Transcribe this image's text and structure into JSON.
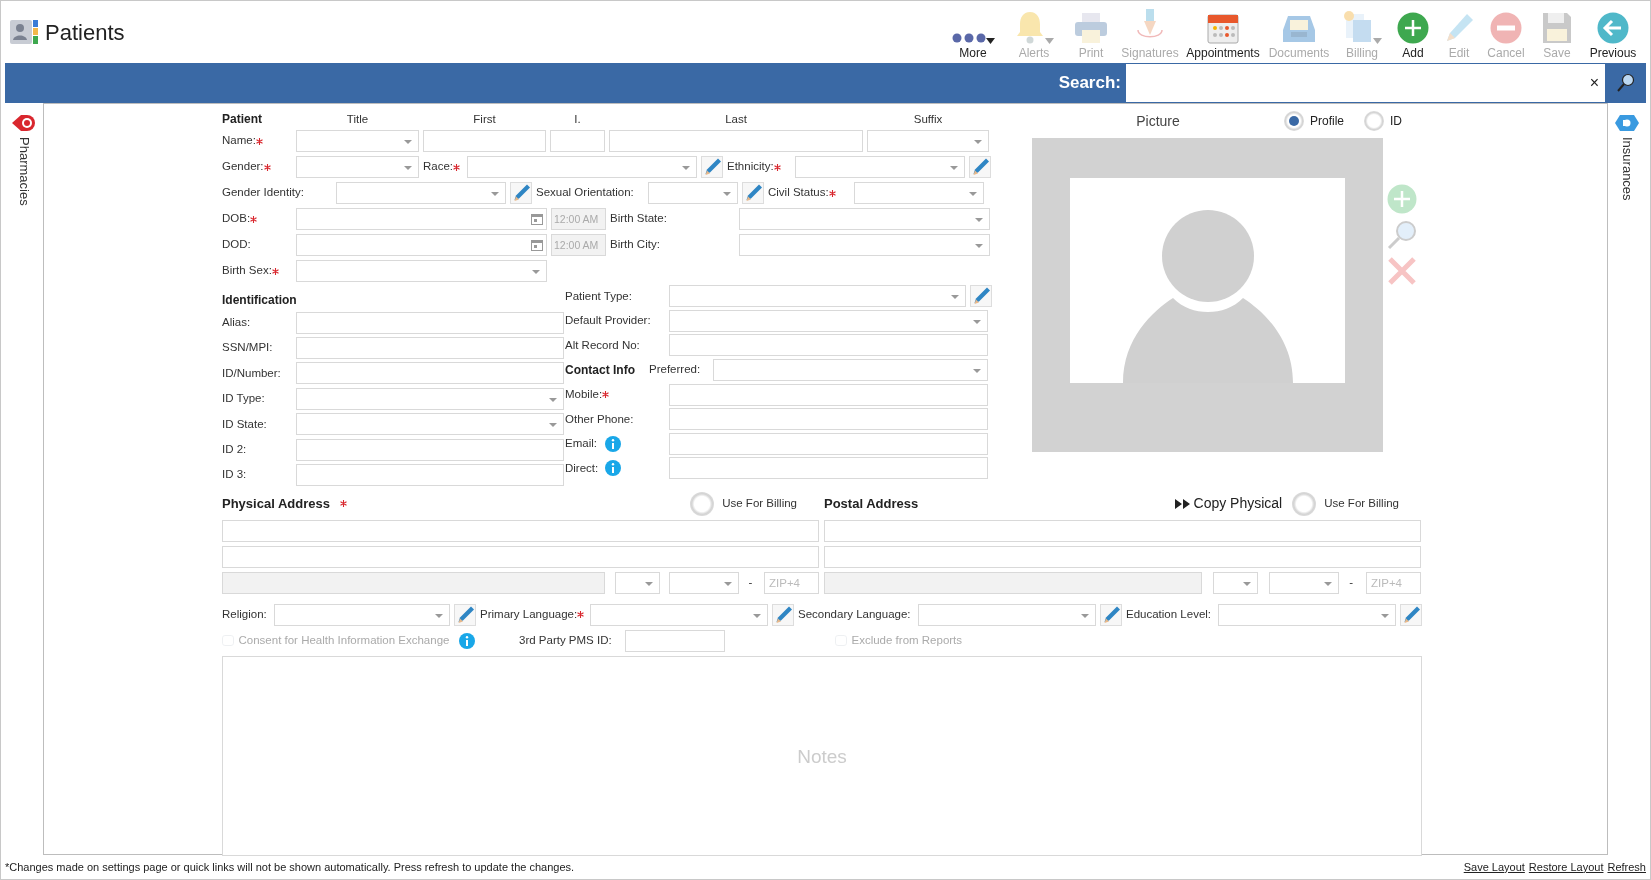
{
  "app": {
    "title": "Patients"
  },
  "toolbar": [
    {
      "label": "More",
      "kind": "more",
      "disabled": false,
      "dropdown": true
    },
    {
      "label": "Alerts",
      "kind": "bell",
      "disabled": true,
      "dropdown": true
    },
    {
      "label": "Print",
      "kind": "printer",
      "disabled": true,
      "dropdown": false
    },
    {
      "label": "Signatures",
      "kind": "pen",
      "disabled": true,
      "dropdown": false
    },
    {
      "label": "Appointments",
      "kind": "calendar",
      "disabled": false,
      "dropdown": false
    },
    {
      "label": "Documents",
      "kind": "tray",
      "disabled": true,
      "dropdown": false
    },
    {
      "label": "Billing",
      "kind": "billing",
      "disabled": true,
      "dropdown": true
    },
    {
      "label": "Add",
      "kind": "add",
      "disabled": false,
      "dropdown": false
    },
    {
      "label": "Edit",
      "kind": "edit",
      "disabled": true,
      "dropdown": false
    },
    {
      "label": "Cancel",
      "kind": "cancel",
      "disabled": true,
      "dropdown": false
    },
    {
      "label": "Save",
      "kind": "save",
      "disabled": true,
      "dropdown": false
    },
    {
      "label": "Previous",
      "kind": "back",
      "disabled": false,
      "dropdown": false
    }
  ],
  "search": {
    "label": "Search:",
    "clear": "×"
  },
  "left_tab": {
    "label": "Pharmacies"
  },
  "right_tab": {
    "label": "Insurances"
  },
  "patient": {
    "heading": "Patient",
    "name_captions": [
      "Title",
      "First",
      "I.",
      "Last",
      "Suffix"
    ],
    "rows": [
      [
        {
          "kind": "label",
          "text": "Name:",
          "required": true
        },
        {
          "kind": "select"
        },
        {
          "kind": "input"
        },
        {
          "kind": "input"
        },
        {
          "kind": "input"
        },
        {
          "kind": "select"
        }
      ],
      [
        {
          "kind": "label",
          "text": "Gender:",
          "required": true
        },
        {
          "kind": "select"
        },
        {
          "kind": "label",
          "text": "Race:",
          "required": true
        },
        {
          "kind": "select"
        },
        {
          "kind": "pencil"
        },
        {
          "kind": "label",
          "text": "Ethnicity:",
          "required": true
        },
        {
          "kind": "select"
        },
        {
          "kind": "pencil"
        }
      ],
      [
        {
          "kind": "label",
          "text": "Gender Identity:",
          "required": false
        },
        {
          "kind": "select"
        },
        {
          "kind": "pencil"
        },
        {
          "kind": "label",
          "text": "Sexual Orientation:",
          "required": false
        },
        {
          "kind": "select"
        },
        {
          "kind": "pencil"
        },
        {
          "kind": "label",
          "text": "Civil Status:",
          "required": true
        },
        {
          "kind": "select"
        }
      ],
      [
        {
          "kind": "label",
          "text": "DOB:",
          "required": true
        },
        {
          "kind": "date"
        },
        {
          "kind": "time",
          "value": "12:00 AM",
          "disabled": true
        },
        {
          "kind": "label",
          "text": "Birth State:",
          "required": false
        },
        {
          "kind": "select"
        }
      ],
      [
        {
          "kind": "label",
          "text": "DOD:",
          "required": false
        },
        {
          "kind": "date"
        },
        {
          "kind": "time",
          "value": "12:00 AM",
          "disabled": true
        },
        {
          "kind": "label",
          "text": "Birth City:",
          "required": false
        },
        {
          "kind": "select"
        }
      ],
      [
        {
          "kind": "label",
          "text": "Birth Sex:",
          "required": true
        },
        {
          "kind": "select"
        }
      ]
    ]
  },
  "identification": {
    "heading": "Identification",
    "rows": [
      [
        {
          "kind": "label",
          "text": "Alias:",
          "required": false
        },
        {
          "kind": "input"
        }
      ],
      [
        {
          "kind": "label",
          "text": "SSN/MPI:",
          "required": false
        },
        {
          "kind": "input"
        }
      ],
      [
        {
          "kind": "label",
          "text": "ID/Number:",
          "required": false
        },
        {
          "kind": "input"
        }
      ],
      [
        {
          "kind": "label",
          "text": "ID Type:",
          "required": false
        },
        {
          "kind": "select"
        }
      ],
      [
        {
          "kind": "label",
          "text": "ID State:",
          "required": false
        },
        {
          "kind": "select"
        }
      ],
      [
        {
          "kind": "label",
          "text": "ID 2:",
          "required": false
        },
        {
          "kind": "input"
        }
      ],
      [
        {
          "kind": "label",
          "text": "ID 3:",
          "required": false
        },
        {
          "kind": "input"
        }
      ]
    ]
  },
  "details": {
    "rows": [
      [
        {
          "kind": "label",
          "text": "Patient Type:",
          "required": false
        },
        {
          "kind": "select"
        },
        {
          "kind": "pencil"
        }
      ],
      [
        {
          "kind": "label",
          "text": "Default Provider:",
          "required": false
        },
        {
          "kind": "select"
        }
      ],
      [
        {
          "kind": "label",
          "text": "Alt Record No:",
          "required": false
        },
        {
          "kind": "input"
        }
      ],
      [
        {
          "kind": "heading",
          "text": "Contact Info"
        },
        {
          "kind": "label",
          "text": "Preferred:",
          "required": false
        },
        {
          "kind": "select"
        }
      ],
      [
        {
          "kind": "label",
          "text": "Mobile:",
          "required": true
        },
        {
          "kind": "input"
        }
      ],
      [
        {
          "kind": "label",
          "text": "Other Phone:",
          "required": false
        },
        {
          "kind": "input"
        }
      ],
      [
        {
          "kind": "label",
          "text": "Email:",
          "required": false
        },
        {
          "kind": "info"
        },
        {
          "kind": "input"
        }
      ],
      [
        {
          "kind": "label",
          "text": "Direct:",
          "required": false
        },
        {
          "kind": "info"
        },
        {
          "kind": "input"
        }
      ]
    ]
  },
  "picture": {
    "title": "Picture",
    "options": [
      {
        "label": "Profile",
        "selected": true
      },
      {
        "label": "ID",
        "selected": false
      }
    ]
  },
  "addresses": [
    {
      "heading": "Physical Address",
      "required": true,
      "billing": {
        "label": "Use For Billing",
        "selected": false
      },
      "lines": [
        [
          {
            "kind": "input"
          }
        ],
        [
          {
            "kind": "input"
          }
        ],
        [
          {
            "kind": "input",
            "disabled": true
          },
          {
            "kind": "select"
          },
          {
            "kind": "select"
          },
          {
            "kind": "dash",
            "text": "-"
          },
          {
            "kind": "input",
            "placeholder": "ZIP+4"
          }
        ]
      ]
    },
    {
      "heading": "Postal Address",
      "required": false,
      "copy": {
        "label": "Copy Physical"
      },
      "billing": {
        "label": "Use For Billing",
        "selected": false
      },
      "lines": [
        [
          {
            "kind": "input"
          }
        ],
        [
          {
            "kind": "input"
          }
        ],
        [
          {
            "kind": "input",
            "disabled": true
          },
          {
            "kind": "select"
          },
          {
            "kind": "select"
          },
          {
            "kind": "dash",
            "text": "-"
          },
          {
            "kind": "input",
            "placeholder": "ZIP+4"
          }
        ]
      ]
    }
  ],
  "demographics": [
    {
      "kind": "label",
      "text": "Religion:",
      "required": false
    },
    {
      "kind": "select"
    },
    {
      "kind": "pencil"
    },
    {
      "kind": "label",
      "text": "Primary Language:",
      "required": true
    },
    {
      "kind": "select"
    },
    {
      "kind": "pencil"
    },
    {
      "kind": "label",
      "text": "Secondary Language:",
      "required": false
    },
    {
      "kind": "select"
    },
    {
      "kind": "pencil"
    },
    {
      "kind": "label",
      "text": "Education Level:",
      "required": false
    },
    {
      "kind": "select"
    },
    {
      "kind": "pencil"
    }
  ],
  "options": [
    {
      "kind": "checkbox",
      "label": "Consent for Health Information Exchange",
      "checked": false,
      "disabled": true
    },
    {
      "kind": "info"
    },
    {
      "kind": "label",
      "text": "3rd Party PMS ID:",
      "required": false
    },
    {
      "kind": "input"
    },
    {
      "kind": "checkbox",
      "label": "Exclude from Reports",
      "checked": false,
      "disabled": true
    }
  ],
  "notes": {
    "placeholder": "Notes"
  },
  "footer": {
    "note": "*Changes made on settings page or quick links will not be shown automatically. Press refresh to update the changes.",
    "links": [
      "Save Layout",
      "Restore Layout",
      "Refresh"
    ]
  }
}
